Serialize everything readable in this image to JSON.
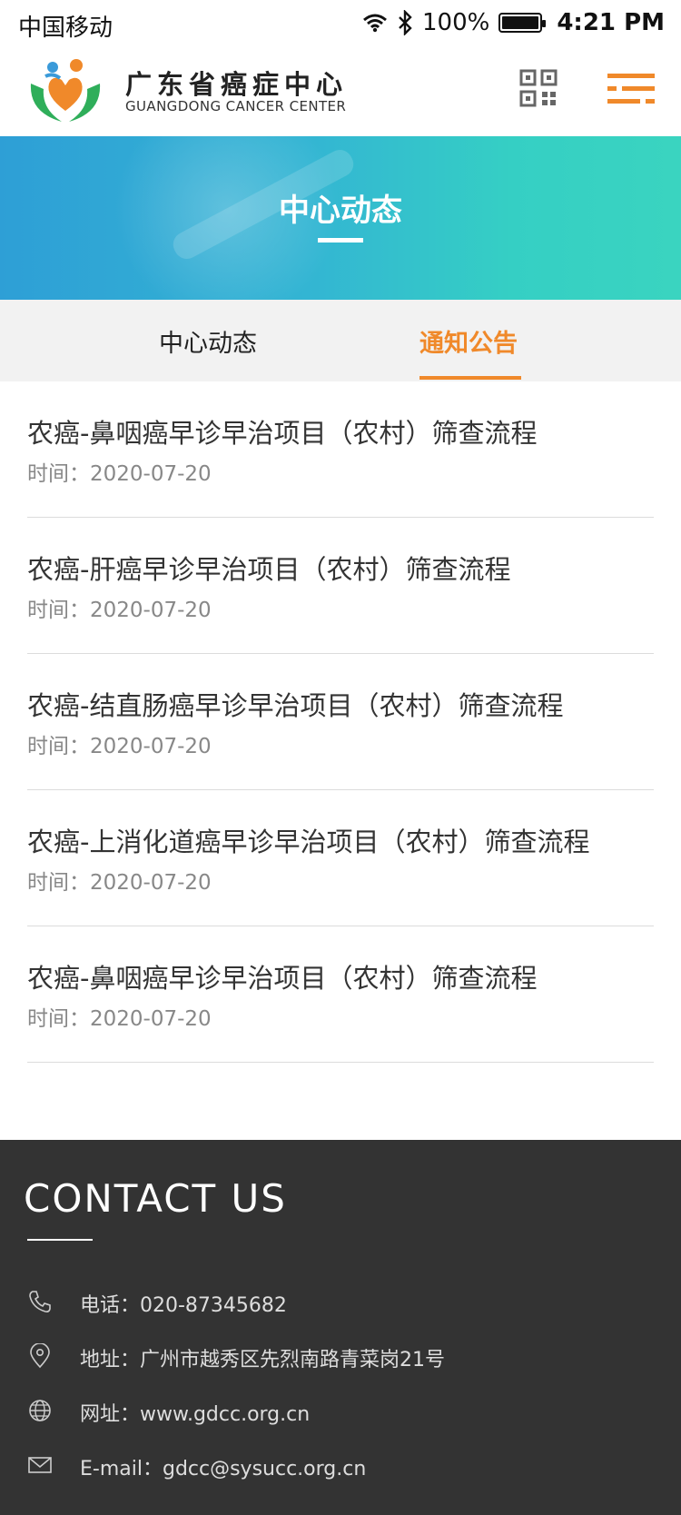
{
  "status_bar": {
    "carrier": "中国移动",
    "battery": "100%",
    "time": "4:21 PM"
  },
  "header": {
    "brand_cn": "广东省癌症中心",
    "brand_en": "GUANGDONG CANCER CENTER",
    "qr_icon": "qr-code-icon",
    "menu_icon": "hamburger-menu-icon",
    "accent_color": "#f0892a"
  },
  "banner": {
    "title": "中心动态"
  },
  "tabs": [
    {
      "label": "中心动态",
      "active": false
    },
    {
      "label": "通知公告",
      "active": true
    }
  ],
  "list": [
    {
      "title": "农癌-鼻咽癌早诊早治项目（农村）筛查流程",
      "time": "时间：2020-07-20"
    },
    {
      "title": "农癌-肝癌早诊早治项目（农村）筛查流程",
      "time": "时间：2020-07-20"
    },
    {
      "title": "农癌-结直肠癌早诊早治项目（农村）筛查流程",
      "time": "时间：2020-07-20"
    },
    {
      "title": "农癌-上消化道癌早诊早治项目（农村）筛查流程",
      "time": "时间：2020-07-20"
    },
    {
      "title": "农癌-鼻咽癌早诊早治项目（农村）筛查流程",
      "time": "时间：2020-07-20"
    }
  ],
  "footer": {
    "title": "CONTACT US",
    "phone": "电话：020-87345682",
    "address": "地址：广州市越秀区先烈南路青菜岗21号",
    "website": "网址：www.gdcc.org.cn",
    "email": "E-mail：gdcc@sysucc.org.cn"
  }
}
